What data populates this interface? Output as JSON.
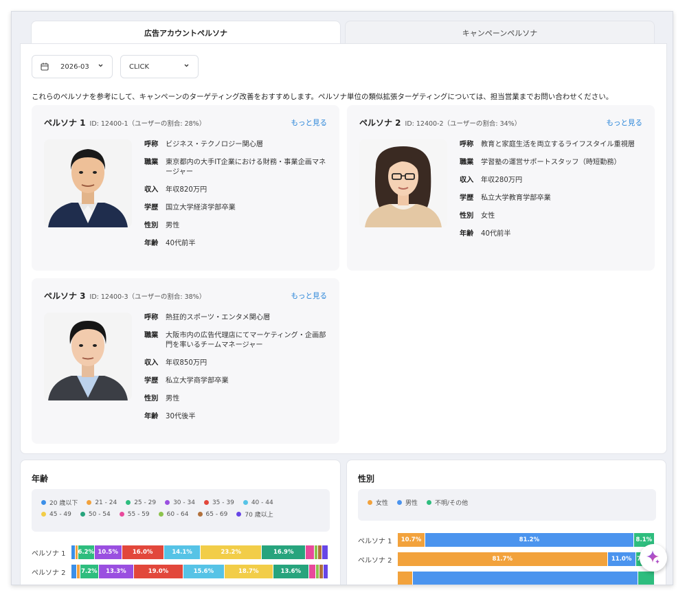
{
  "tabs": [
    {
      "label": "広告アカウントペルソナ",
      "active": true
    },
    {
      "label": "キャンペーンペルソナ",
      "active": false
    }
  ],
  "filters": {
    "month": {
      "value": "2026-03",
      "icon": "calendar-icon"
    },
    "metric": {
      "value": "CLICK"
    }
  },
  "intro": "これらのペルソナを参考にして、キャンペーンのターゲティング改善をおすすめします。ペルソナ単位の類似拡張ターゲティングについては、担当営業までお問い合わせください。",
  "more_label": "もっと見る",
  "attr_keys": {
    "alias": "呼称",
    "job": "職業",
    "income": "収入",
    "edu": "学歴",
    "gender": "性別",
    "age": "年齢"
  },
  "personas": [
    {
      "name": "ペルソナ 1",
      "meta": "ID: 12400-1（ユーザーの割合: 28%）",
      "alias": "ビジネス・テクノロジー関心層",
      "job": "東京都内の大手IT企業における財務・事業企画マネージャー",
      "income": "年収820万円",
      "edu": "国立大学経済学部卒業",
      "gender": "男性",
      "age": "40代前半"
    },
    {
      "name": "ペルソナ 2",
      "meta": "ID: 12400-2（ユーザーの割合: 34%）",
      "alias": "教育と家庭生活を両立するライフスタイル重視層",
      "job": "学習塾の運営サポートスタッフ（時短勤務）",
      "income": "年収280万円",
      "edu": "私立大学教育学部卒業",
      "gender": "女性",
      "age": "40代前半"
    },
    {
      "name": "ペルソナ 3",
      "meta": "ID: 12400-3（ユーザーの割合: 38%）",
      "alias": "熱狂的スポーツ・エンタメ関心層",
      "job": "大阪市内の広告代理店にてマーケティング・企画部門を率いるチームマネージャー",
      "income": "年収850万円",
      "edu": "私立大学商学部卒業",
      "gender": "男性",
      "age": "30代後半"
    }
  ],
  "age_section": {
    "title": "年齢",
    "legend": [
      {
        "label": "20 歳以下",
        "color": "#3b8fe8"
      },
      {
        "label": "21 - 24",
        "color": "#f2a23c"
      },
      {
        "label": "25 - 29",
        "color": "#2ebd7e"
      },
      {
        "label": "30 - 34",
        "color": "#9a4fe0"
      },
      {
        "label": "35 - 39",
        "color": "#e2473b"
      },
      {
        "label": "40 - 44",
        "color": "#56c3e6"
      },
      {
        "label": "45 - 49",
        "color": "#f2cd48"
      },
      {
        "label": "50 - 54",
        "color": "#27a47d"
      },
      {
        "label": "55 - 59",
        "color": "#e84a9b"
      },
      {
        "label": "60 - 64",
        "color": "#8cc34c"
      },
      {
        "label": "65 - 69",
        "color": "#b2713c"
      },
      {
        "label": "70 歳以上",
        "color": "#6746e6"
      }
    ],
    "rows": [
      {
        "label": "ペルソナ 1",
        "segments": [
          {
            "value": 1.6,
            "text": ""
          },
          {
            "value": 1.0,
            "text": ""
          },
          {
            "value": 6.2,
            "text": "6.2%"
          },
          {
            "value": 10.5,
            "text": "10.5%"
          },
          {
            "value": 16.0,
            "text": "16.0%"
          },
          {
            "value": 14.1,
            "text": "14.1%"
          },
          {
            "value": 23.2,
            "text": "23.2%"
          },
          {
            "value": 16.9,
            "text": "16.9%"
          },
          {
            "value": 3.4,
            "text": ""
          },
          {
            "value": 1.2,
            "text": ""
          },
          {
            "value": 1.5,
            "text": ""
          },
          {
            "value": 2.4,
            "text": ""
          }
        ]
      },
      {
        "label": "ペルソナ 2",
        "segments": [
          {
            "value": 2.1,
            "text": ""
          },
          {
            "value": 1.2,
            "text": ""
          },
          {
            "value": 7.2,
            "text": "7.2%"
          },
          {
            "value": 13.3,
            "text": "13.3%"
          },
          {
            "value": 19.0,
            "text": "19.0%"
          },
          {
            "value": 15.6,
            "text": "15.6%"
          },
          {
            "value": 18.7,
            "text": "18.7%"
          },
          {
            "value": 13.6,
            "text": "13.6%"
          },
          {
            "value": 2.7,
            "text": ""
          },
          {
            "value": 1.4,
            "text": ""
          },
          {
            "value": 1.5,
            "text": ""
          },
          {
            "value": 1.8,
            "text": ""
          }
        ]
      }
    ]
  },
  "gender_section": {
    "title": "性別",
    "legend": [
      {
        "label": "女性",
        "color": "#f2a23c"
      },
      {
        "label": "男性",
        "color": "#4b94ee"
      },
      {
        "label": "不明/その他",
        "color": "#2ebd7e"
      }
    ],
    "rows": [
      {
        "label": "ペルソナ 1",
        "segments": [
          {
            "value": 10.7,
            "text": "10.7%"
          },
          {
            "value": 81.2,
            "text": "81.2%"
          },
          {
            "value": 8.1,
            "text": "8.1%"
          }
        ]
      },
      {
        "label": "ペルソナ 2",
        "segments": [
          {
            "value": 81.7,
            "text": "81.7%"
          },
          {
            "value": 11.0,
            "text": "11.0%"
          },
          {
            "value": 7.3,
            "text": "7.3%"
          }
        ]
      },
      {
        "label": "",
        "segments": [
          {
            "value": 6.0,
            "text": ""
          },
          {
            "value": 87.5,
            "text": ""
          },
          {
            "value": 6.5,
            "text": ""
          }
        ]
      }
    ]
  },
  "fab": {
    "icon": "sparkle-icon"
  }
}
